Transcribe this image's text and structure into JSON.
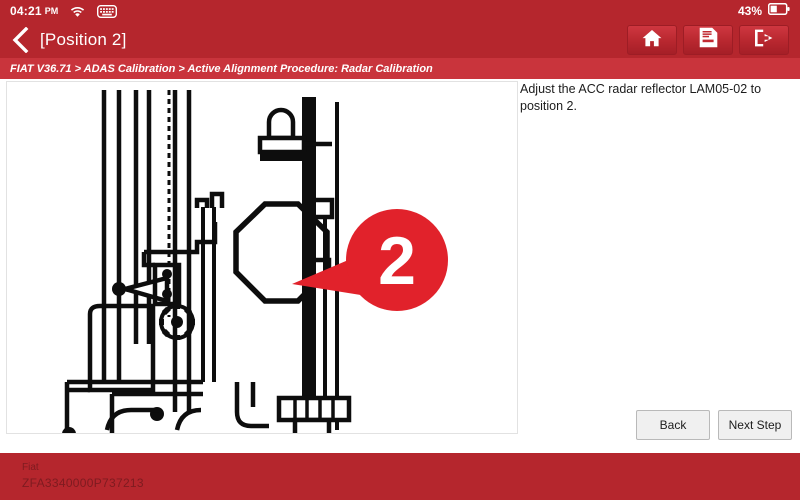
{
  "statusbar": {
    "time": "04:21",
    "ampm": "PM",
    "wifi_icon": "wifi-icon",
    "keyboard_icon": "keyboard-icon",
    "battery_percent": "43%",
    "battery_icon": "battery-icon"
  },
  "titlebar": {
    "back_icon": "chevron-left-icon",
    "title": "[Position 2]",
    "actions": [
      {
        "name": "home-button",
        "icon": "home-icon"
      },
      {
        "name": "report-button",
        "icon": "report-document-icon"
      },
      {
        "name": "exit-button",
        "icon": "exit-arrow-icon"
      }
    ]
  },
  "breadcrumb": {
    "text": "FIAT V36.71 > ADAS Calibration > Active Alignment Procedure: Radar Calibration"
  },
  "main": {
    "instruction": "Adjust the ACC radar reflector LAM05-02 to position 2.",
    "diagram": {
      "callout_label": "2",
      "description": "Line drawing of ADAS radar calibration rig with reflector target"
    },
    "back_label": "Back",
    "next_label": "Next Step"
  },
  "footer": {
    "make": "Fiat",
    "vin": "ZFA3340000P737213"
  },
  "colors": {
    "brand_red": "#b5262d",
    "breadcrumb_red": "#c9343c",
    "callout_red": "#e1222b",
    "footer_text": "#7e1b20"
  }
}
